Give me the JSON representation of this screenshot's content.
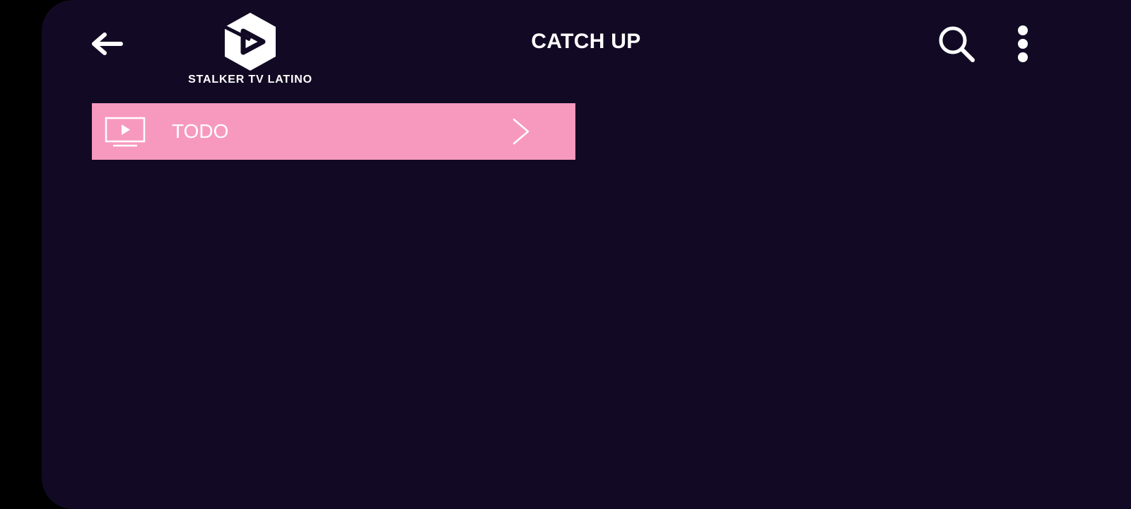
{
  "header": {
    "title": "CATCH UP",
    "logo_text": "STALKER TV LATINO",
    "back_icon": "arrow-left-icon",
    "search_icon": "search-icon",
    "more_icon": "more-vertical-icon"
  },
  "categories": [
    {
      "label": "TODO",
      "icon": "tv-play-icon",
      "trailing_icon": "chevron-right-icon"
    }
  ],
  "colors": {
    "background": "#120a24",
    "item_background": "#f799bf",
    "text": "#ffffff"
  }
}
